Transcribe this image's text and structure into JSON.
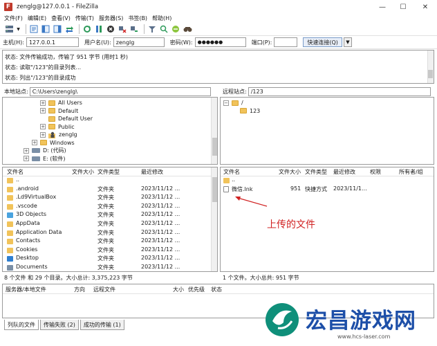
{
  "window": {
    "title": "zenglg@127.0.0.1 - FileZilla",
    "app_icon_letter": "F",
    "minimize": "—",
    "maximize": "☐",
    "close": "✕"
  },
  "menu": [
    "文件(F)",
    "编辑(E)",
    "查看(V)",
    "传输(T)",
    "服务器(S)",
    "书签(B)",
    "帮助(H)"
  ],
  "connect": {
    "host_label": "主机(H):",
    "host_value": "127.0.0.1",
    "user_label": "用户名(U):",
    "user_value": "zenglg",
    "pass_label": "密码(W):",
    "pass_value": "●●●●●●",
    "port_label": "端口(P):",
    "port_value": "",
    "quickconnect_label": "快速连接(Q)",
    "dropdown_icon": "▼"
  },
  "log": [
    "状态: 文件传输成功，传输了 951 字节 (用时1 秒)",
    "状态: 读取\"/123\"的目录列表...",
    "状态: 列出\"/123\"的目录成功"
  ],
  "local": {
    "site_label": "本地站点:",
    "path": "C:\\Users\\zenglg\\",
    "tree": [
      {
        "label": "All Users",
        "type": "folder",
        "expander": "+",
        "indent": 2
      },
      {
        "label": "Default",
        "type": "folder",
        "expander": "+",
        "indent": 2
      },
      {
        "label": "Default User",
        "type": "folder",
        "expander": "",
        "indent": 2
      },
      {
        "label": "Public",
        "type": "folder",
        "expander": "+",
        "indent": 2
      },
      {
        "label": "zenglg",
        "type": "user",
        "expander": "+",
        "indent": 2
      },
      {
        "label": "Windows",
        "type": "folder",
        "expander": "+",
        "indent": 1
      },
      {
        "label": "D: (代码)",
        "type": "drive",
        "expander": "+",
        "indent": 0
      },
      {
        "label": "E: (软件)",
        "type": "drive",
        "expander": "+",
        "indent": 0
      }
    ],
    "columns": [
      "文件名",
      "文件大小",
      "文件类型",
      "最近修改"
    ],
    "files": [
      {
        "name": "..",
        "size": "",
        "type": "",
        "modified": "",
        "icon": "folder"
      },
      {
        "name": ".android",
        "size": "",
        "type": "文件夹",
        "modified": "2023/11/12 ...",
        "icon": "folder"
      },
      {
        "name": ".Ld9VirtualBox",
        "size": "",
        "type": "文件夹",
        "modified": "2023/11/12 ...",
        "icon": "folder"
      },
      {
        "name": ".vscode",
        "size": "",
        "type": "文件夹",
        "modified": "2023/11/12 ...",
        "icon": "folder"
      },
      {
        "name": "3D Objects",
        "size": "",
        "type": "文件夹",
        "modified": "2023/11/12 ...",
        "icon": "3d"
      },
      {
        "name": "AppData",
        "size": "",
        "type": "文件夹",
        "modified": "2023/11/12 ...",
        "icon": "folder"
      },
      {
        "name": "Application Data",
        "size": "",
        "type": "文件夹",
        "modified": "2023/11/12 ...",
        "icon": "folder"
      },
      {
        "name": "Contacts",
        "size": "",
        "type": "文件夹",
        "modified": "2023/11/12 ...",
        "icon": "folder"
      },
      {
        "name": "Cookies",
        "size": "",
        "type": "文件夹",
        "modified": "2023/11/12 ...",
        "icon": "folder"
      },
      {
        "name": "Desktop",
        "size": "",
        "type": "文件夹",
        "modified": "2023/11/12 ...",
        "icon": "desktop"
      },
      {
        "name": "Documents",
        "size": "",
        "type": "文件夹",
        "modified": "2023/11/12 ...",
        "icon": "docs"
      }
    ],
    "status": "8 个文件 和 29 个目录。大小总计: 3,375,223 字节"
  },
  "remote": {
    "site_label": "远程站点:",
    "path": "/123",
    "tree": [
      {
        "label": "/",
        "expander": "−"
      },
      {
        "label": "123",
        "expander": ""
      }
    ],
    "columns": [
      "文件名",
      "文件大小",
      "文件类型",
      "最近修改",
      "权限",
      "所有者/组"
    ],
    "files": [
      {
        "name": "..",
        "size": "",
        "type": "",
        "modified": "",
        "icon": "folder"
      },
      {
        "name": "微信.lnk",
        "size": "951",
        "type": "快捷方式",
        "modified": "2023/11/1...",
        "icon": "file"
      }
    ],
    "status": "1 个文件。大小总共: 951 字节"
  },
  "queue": {
    "columns": [
      "服务器/本地文件",
      "方向",
      "远程文件",
      "大小",
      "优先级",
      "状态"
    ]
  },
  "tabs": [
    "列队的文件",
    "传输失败 (2)",
    "成功的传输 (1)"
  ],
  "annotation": {
    "text": "上传的文件",
    "color": "#d02020"
  },
  "watermark": {
    "title": "宏昌游戏网",
    "url": "www.hcs-laser.com",
    "color": "#1d4fa8"
  },
  "colors": {
    "folder": "#f1c35a",
    "accent": "#3b78c4"
  }
}
